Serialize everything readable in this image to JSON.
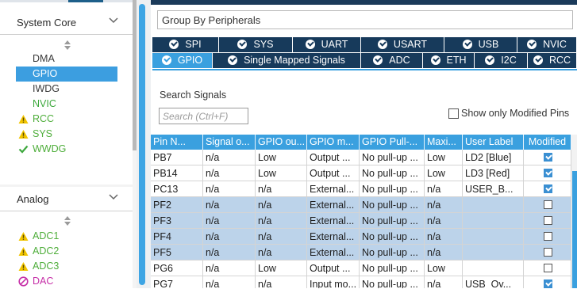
{
  "left_panel": {
    "sections": [
      {
        "title": "System Core",
        "items": [
          {
            "label": "DMA",
            "state": "plain"
          },
          {
            "label": "GPIO",
            "state": "selected"
          },
          {
            "label": "IWDG",
            "state": "plain"
          },
          {
            "label": "NVIC",
            "state": "green"
          },
          {
            "label": "RCC",
            "state": "warning",
            "icon": "warning-triangle-icon"
          },
          {
            "label": "SYS",
            "state": "warning",
            "icon": "warning-triangle-icon"
          },
          {
            "label": "WWDG",
            "state": "ok",
            "icon": "checkmark-icon"
          }
        ]
      },
      {
        "title": "Analog",
        "items": [
          {
            "label": "ADC1",
            "state": "warning",
            "icon": "warning-triangle-icon"
          },
          {
            "label": "ADC2",
            "state": "warning",
            "icon": "warning-triangle-icon"
          },
          {
            "label": "ADC3",
            "state": "warning",
            "icon": "warning-triangle-icon"
          },
          {
            "label": "DAC",
            "state": "disabled",
            "icon": "no-entry-icon"
          }
        ]
      }
    ]
  },
  "right_panel": {
    "group_select": "Group By Peripherals",
    "tabs_row1": [
      "SPI",
      "SYS",
      "UART",
      "USART",
      "USB",
      "NVIC"
    ],
    "tabs_row2": [
      "GPIO",
      "Single Mapped Signals",
      "ADC",
      "ETH",
      "I2C",
      "RCC"
    ],
    "active_tab": "GPIO",
    "search": {
      "label": "Search Signals",
      "placeholder": "Search (Ctrl+F)"
    },
    "show_modified_label": "Show only Modified Pins",
    "table": {
      "columns": [
        "Pin N...",
        "Signal o...",
        "GPIO ou...",
        "GPIO m...",
        "GPIO Pull-...",
        "Maxi...",
        "User Label",
        "Modified"
      ],
      "rows": [
        {
          "cells": [
            "PB7",
            "n/a",
            "Low",
            "Output ...",
            "No pull-up ...",
            "Low",
            "LD2 [Blue]"
          ],
          "modified": true,
          "selected": false
        },
        {
          "cells": [
            "PB14",
            "n/a",
            "Low",
            "Output ...",
            "No pull-up ...",
            "Low",
            "LD3 [Red]"
          ],
          "modified": true,
          "selected": false
        },
        {
          "cells": [
            "PC13",
            "n/a",
            "n/a",
            "External...",
            "No pull-up ...",
            "n/a",
            "USER_B..."
          ],
          "modified": true,
          "selected": false
        },
        {
          "cells": [
            "PF2",
            "n/a",
            "n/a",
            "External...",
            "No pull-up ...",
            "n/a",
            ""
          ],
          "modified": false,
          "selected": true
        },
        {
          "cells": [
            "PF3",
            "n/a",
            "n/a",
            "External...",
            "No pull-up ...",
            "n/a",
            ""
          ],
          "modified": false,
          "selected": true
        },
        {
          "cells": [
            "PF4",
            "n/a",
            "n/a",
            "External...",
            "No pull-up ...",
            "n/a",
            ""
          ],
          "modified": false,
          "selected": true
        },
        {
          "cells": [
            "PF5",
            "n/a",
            "n/a",
            "External...",
            "No pull-up ...",
            "n/a",
            ""
          ],
          "modified": false,
          "selected": true
        },
        {
          "cells": [
            "PG6",
            "n/a",
            "Low",
            "Output ...",
            "No pull-up ...",
            "Low",
            ""
          ],
          "modified": false,
          "selected": false
        },
        {
          "cells": [
            "PG7",
            "n/a",
            "n/a",
            "Input mo...",
            "No pull-up ...",
            "n/a",
            "USB_Ov..."
          ],
          "modified": true,
          "selected": false
        }
      ]
    }
  },
  "colors": {
    "tab_dark": "#173a5b",
    "tab_active": "#3aa0df",
    "selection": "#3c9ee0",
    "row_selected": "#bcd3ea",
    "warning": "#f2c500",
    "ok_green": "#3da83d",
    "disabled_magenta": "#c62fa8"
  }
}
